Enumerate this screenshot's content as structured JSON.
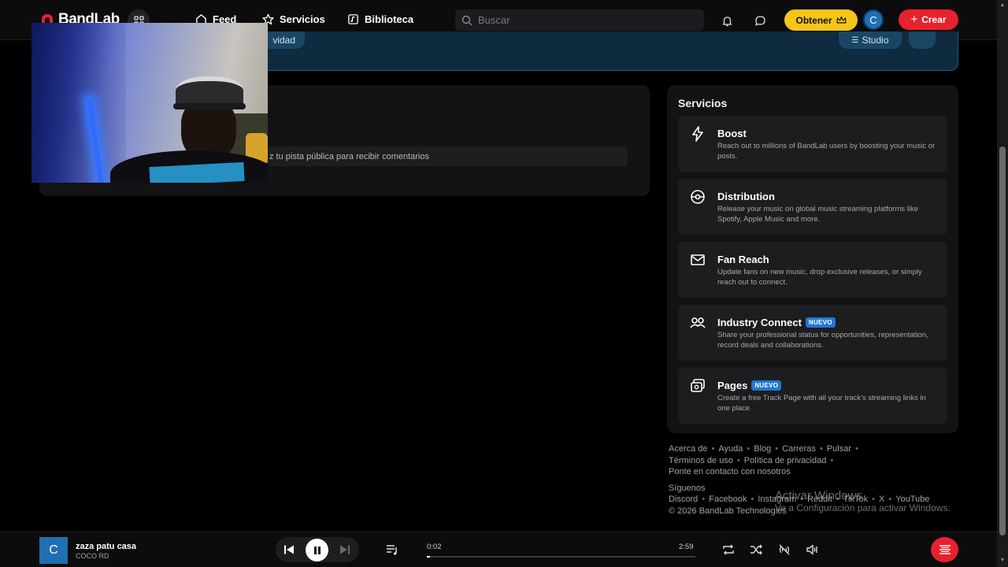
{
  "brand": {
    "name": "BandLab",
    "color": "#e6222f"
  },
  "nav": {
    "feed": "Feed",
    "services": "Servicios",
    "library": "Biblioteca",
    "search_placeholder": "Buscar",
    "obtain_label": "Obtener",
    "avatar_initial": "C",
    "create_label": "Crear"
  },
  "banner": {
    "left_pill": "vidad",
    "right_pill": "Studio"
  },
  "main_card": {
    "hint_text": "z tu pista pública para recibir comentarios"
  },
  "services": {
    "title": "Servicios",
    "items": [
      {
        "icon": "bolt-icon",
        "name": "Boost",
        "badge": "",
        "desc": "Reach out to millions of BandLab users by boosting your music or posts."
      },
      {
        "icon": "globe-icon",
        "name": "Distribution",
        "badge": "",
        "desc": "Release your music on global music streaming platforms like Spotify, Apple Music and more."
      },
      {
        "icon": "mail-icon",
        "name": "Fan Reach",
        "badge": "",
        "desc": "Update fans on new music, drop exclusive releases, or simply reach out to connect."
      },
      {
        "icon": "handshake-icon",
        "name": "Industry Connect",
        "badge": "NUEVO",
        "desc": "Share your professional status for opportunities, representation, record deals and collaborations."
      },
      {
        "icon": "pages-icon",
        "name": "Pages",
        "badge": "NUEVO",
        "desc": "Create a free Track Page with all your track's streaming links in one place"
      }
    ]
  },
  "footer": {
    "links_row1": [
      "Acerca de",
      "Ayuda",
      "Blog",
      "Carreras",
      "Pulsar"
    ],
    "links_row2": [
      "Términos de uso",
      "Política de privacidad"
    ],
    "contact": "Ponte en contacto con nosotros",
    "follow_label": "Síguenos",
    "social": [
      "Discord",
      "Facebook",
      "Instagram",
      "Reddit",
      "TikTok",
      "X",
      "YouTube"
    ],
    "copyright": "© 2026 BandLab Technologies"
  },
  "watermark": {
    "line1": "Activar Windows",
    "line2": "Ve a Configuración para activar Windows."
  },
  "player": {
    "cover_initial": "C",
    "track_title": "zaza patu casa",
    "artist": "COCO RD",
    "time_current": "0:02",
    "time_total": "2:59",
    "progress": 0.011
  }
}
